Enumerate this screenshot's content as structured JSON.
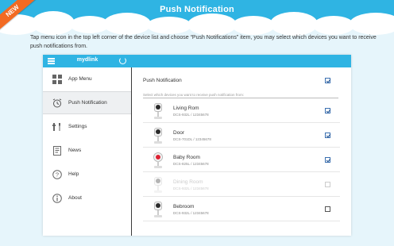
{
  "banner": {
    "title": "Push Notification",
    "ribbon": "NEW",
    "color": "#2fb4e3"
  },
  "intro": "Tap menu icon in the top left corner of the device list and choose “Push Notifications” item, you may select which devices you want to receive push notifications from.",
  "app": {
    "brand": "mydlink",
    "menu_icon": "hamburger-icon",
    "refresh_icon": "refresh-icon"
  },
  "sidebar": {
    "items": [
      {
        "label": "App Menu",
        "icon": "grid-icon",
        "active": false
      },
      {
        "label": "Push Notification",
        "icon": "alarm-clock-icon",
        "active": true
      },
      {
        "label": "Settings",
        "icon": "wrench-icon",
        "active": false
      },
      {
        "label": "News",
        "icon": "news-icon",
        "active": false
      },
      {
        "label": "Help",
        "icon": "help-icon",
        "active": false
      },
      {
        "label": "About",
        "icon": "info-icon",
        "active": false
      }
    ]
  },
  "content": {
    "push_label": "Push Notification",
    "push_checked": true,
    "hint": "Select which devices you want to receive push notification from:",
    "devices": [
      {
        "name": "Living Rom",
        "model": "DCS-932L / 12345678",
        "checked": true,
        "disabled": false,
        "camera": "cube"
      },
      {
        "name": "Door",
        "model": "DCS-701DL / 12345678",
        "checked": true,
        "disabled": false,
        "camera": "cube"
      },
      {
        "name": "Baby Room",
        "model": "DCS-825L / 12345678",
        "checked": true,
        "disabled": false,
        "camera": "baby"
      },
      {
        "name": "Dining Room",
        "model": "DCS-932L / 12345678",
        "checked": false,
        "disabled": true,
        "camera": "cube"
      },
      {
        "name": "Bebroom",
        "model": "DCS-932L / 12345678",
        "checked": false,
        "disabled": false,
        "camera": "cube"
      }
    ]
  }
}
